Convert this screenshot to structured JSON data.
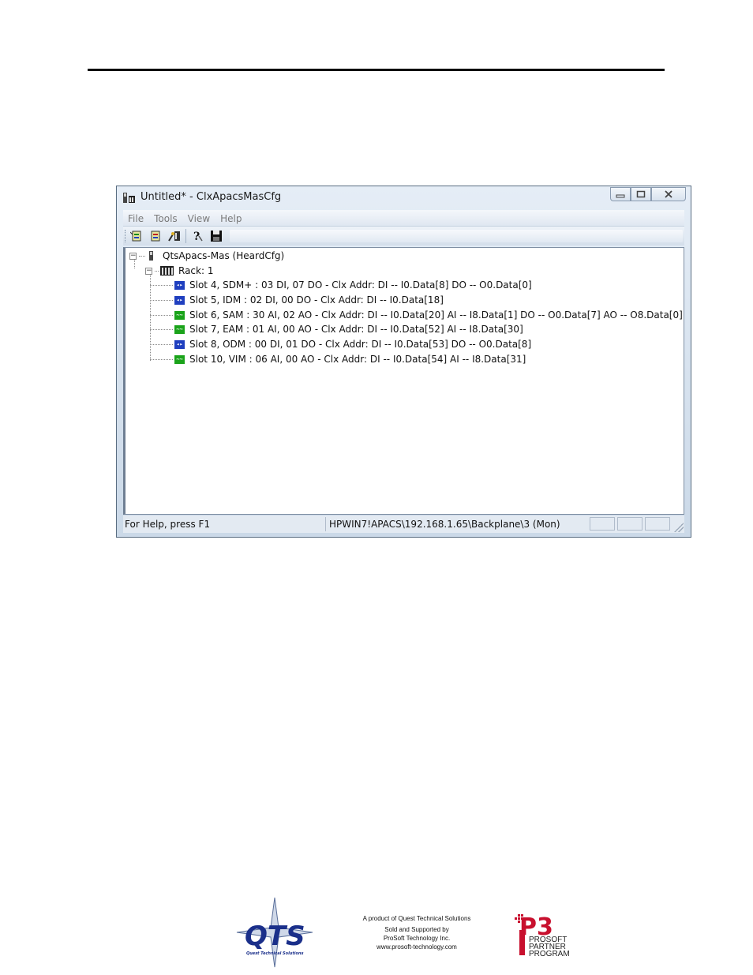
{
  "window": {
    "title": "Untitled* - ClxApacsMasCfg",
    "controls": [
      "minimize",
      "maximize",
      "close"
    ]
  },
  "menubar": {
    "items": [
      "File",
      "Tools",
      "View",
      "Help"
    ]
  },
  "toolbar": {
    "buttons": [
      "connect-icon",
      "disconnect-icon",
      "configure-icon",
      "help-icon",
      "save-icon"
    ]
  },
  "tree": {
    "root_label": "QtsApacs-Mas (HeardCfg)",
    "rack_label": "Rack: 1",
    "slots": [
      {
        "label": "Slot 4, SDM+ : 03 DI, 07 DO - Clx Addr: DI -- I0.Data[8]  DO -- O0.Data[0]",
        "icon": "digital-module-icon",
        "color": "#1f3fbf"
      },
      {
        "label": "Slot 5, IDM : 02 DI, 00 DO - Clx Addr: DI -- I0.Data[18]",
        "icon": "digital-module-icon",
        "color": "#1f3fbf"
      },
      {
        "label": "Slot 6, SAM : 30 AI, 02 AO  - Clx Addr: DI -- I0.Data[20] AI -- I8.Data[1] DO -- O0.Data[7] AO -- O8.Data[0]",
        "icon": "analog-module-icon",
        "color": "#1aa31a"
      },
      {
        "label": "Slot 7, EAM : 01 AI, 00 AO  - Clx Addr: DI -- I0.Data[52] AI -- I8.Data[30]",
        "icon": "analog-module-icon",
        "color": "#1aa31a"
      },
      {
        "label": "Slot 8, ODM : 00 DI, 01 DO - Clx Addr: DI -- I0.Data[53]  DO -- O0.Data[8]",
        "icon": "digital-module-icon",
        "color": "#1f3fbf"
      },
      {
        "label": "Slot 10, VIM : 06 AI, 00 AO  - Clx Addr: DI -- I0.Data[54] AI -- I8.Data[31]",
        "icon": "analog-module-icon",
        "color": "#1aa31a"
      }
    ]
  },
  "statusbar": {
    "help": "For Help, press F1",
    "path": "HPWIN7!APACS\\192.168.1.65\\Backplane\\3 (Mon)"
  },
  "footer": {
    "qts_logo_text": "QTS",
    "qts_logo_sub": "Quest Technical Solutions",
    "lines": [
      "A product of Quest Technical Solutions",
      "Sold and Supported by",
      "ProSoft Technology Inc.",
      "www.prosoft-technology.com"
    ],
    "p3_logo_text": "P3",
    "p3_lines": [
      "PROSOFT",
      "PARTNER",
      "PROGRAM"
    ]
  }
}
